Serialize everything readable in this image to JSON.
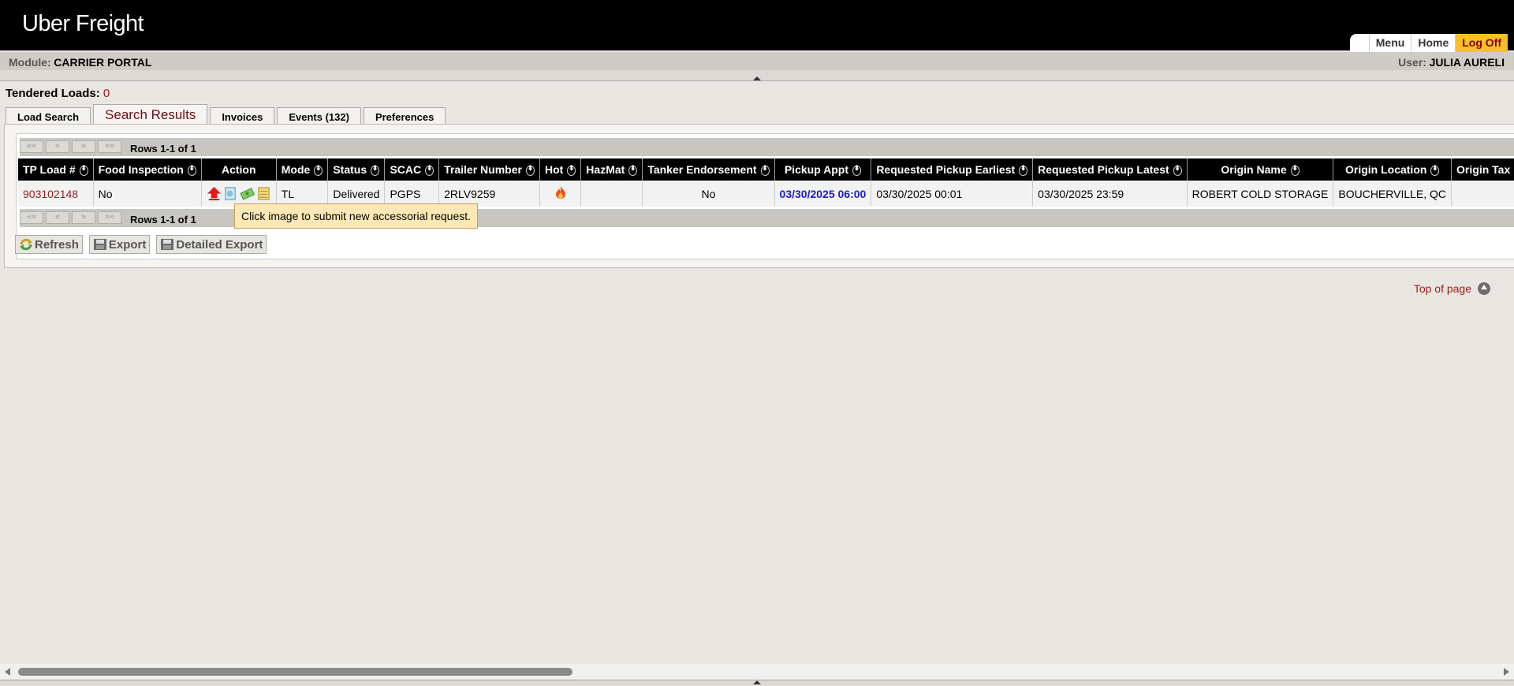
{
  "app": {
    "logo": "Uber Freight"
  },
  "topnav": {
    "menu": "Menu",
    "home": "Home",
    "logoff": "Log Off"
  },
  "module": {
    "label": "Module:",
    "value": "CARRIER PORTAL",
    "user_label": "User:",
    "user_value": "JULIA AURELI"
  },
  "tendered": {
    "label": "Tendered Loads:",
    "count": "0"
  },
  "tabs": [
    {
      "label": "Load Search"
    },
    {
      "label": "Search Results",
      "active": true
    },
    {
      "label": "Invoices"
    },
    {
      "label": "Events (132)"
    },
    {
      "label": "Preferences"
    }
  ],
  "pager": {
    "first": "««",
    "prev": "«",
    "next": "»",
    "last": "»»",
    "rows_text": "Rows 1-1 of 1"
  },
  "table": {
    "headers": [
      "TP Load #",
      "Food Inspection",
      "Action",
      "Mode",
      "Status",
      "SCAC",
      "Trailer Number",
      "Hot",
      "HazMat",
      "Tanker Endorsement",
      "Pickup Appt",
      "Requested Pickup Earliest",
      "Requested Pickup Latest",
      "Origin Name",
      "Origin Location",
      "Origin Tax I"
    ],
    "row": {
      "tp_load": "903102148",
      "food_inspection": "No",
      "mode": "TL",
      "status": "Delivered",
      "scac": "PGPS",
      "trailer": "2RLV9259",
      "hazmat": "",
      "tanker": "No",
      "pickup_appt": "03/30/2025 06:00",
      "req_earliest": "03/30/2025 00:01",
      "req_latest": "03/30/2025 23:59",
      "origin_name": "ROBERT COLD STORAGE",
      "origin_location": "BOUCHERVILLE, QC",
      "origin_tax": ""
    },
    "action_icons": [
      "upload-arrow-icon",
      "document-icon",
      "money-icon",
      "notes-icon"
    ],
    "hot_icon": "flame-icon"
  },
  "tooltip": "Click image to submit new accessorial request.",
  "buttons": {
    "refresh": "Refresh",
    "export": "Export",
    "detailed_export": "Detailed Export"
  },
  "top_of_page": "Top of page",
  "colors": {
    "accent": "#9a1b1b",
    "logoff_bg": "#f7c02a",
    "link_blue": "#1d1dc7"
  }
}
